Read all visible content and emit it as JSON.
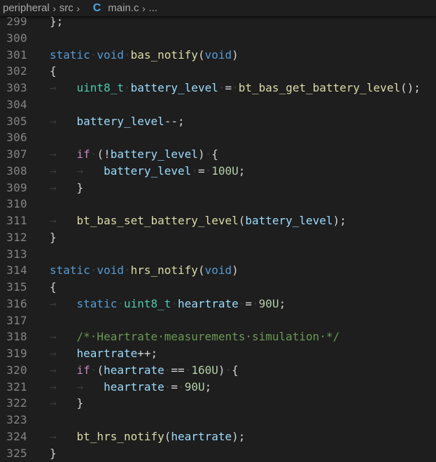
{
  "breadcrumb": {
    "folder": "peripheral",
    "subfolder": "src",
    "file_icon": "C",
    "file": "main.c",
    "more": "..."
  },
  "code_lines": [
    {
      "num": "299",
      "tokens": [
        [
          "p",
          "};"
        ]
      ]
    },
    {
      "num": "300",
      "tokens": []
    },
    {
      "num": "301",
      "tokens": [
        [
          "kw",
          "static"
        ],
        [
          "ws",
          "·"
        ],
        [
          "kw",
          "void"
        ],
        [
          "ws",
          "·"
        ],
        [
          "fn",
          "bas_notify"
        ],
        [
          "p",
          "("
        ],
        [
          "kw",
          "void"
        ],
        [
          "p",
          ")"
        ]
      ]
    },
    {
      "num": "302",
      "tokens": [
        [
          "p",
          "{"
        ]
      ]
    },
    {
      "num": "303",
      "tokens": [
        [
          "ws",
          "→   "
        ],
        [
          "ty",
          "uint8_t"
        ],
        [
          "ws",
          "·"
        ],
        [
          "var",
          "battery_level"
        ],
        [
          "ws",
          "·"
        ],
        [
          "p",
          "="
        ],
        [
          "ws",
          "·"
        ],
        [
          "fn",
          "bt_bas_get_battery_level"
        ],
        [
          "p",
          "();"
        ]
      ]
    },
    {
      "num": "304",
      "tokens": []
    },
    {
      "num": "305",
      "tokens": [
        [
          "ws",
          "→   "
        ],
        [
          "var",
          "battery_level"
        ],
        [
          "p",
          "--;"
        ]
      ]
    },
    {
      "num": "306",
      "tokens": []
    },
    {
      "num": "307",
      "tokens": [
        [
          "ws",
          "→   "
        ],
        [
          "ctl",
          "if"
        ],
        [
          "ws",
          "·"
        ],
        [
          "p",
          "(!"
        ],
        [
          "var",
          "battery_level"
        ],
        [
          "p",
          ")"
        ],
        [
          "ws",
          "·"
        ],
        [
          "p",
          "{"
        ]
      ]
    },
    {
      "num": "308",
      "tokens": [
        [
          "ws",
          "→   →   "
        ],
        [
          "var",
          "battery_level"
        ],
        [
          "ws",
          "·"
        ],
        [
          "p",
          "="
        ],
        [
          "ws",
          "·"
        ],
        [
          "num",
          "100U"
        ],
        [
          "p",
          ";"
        ]
      ]
    },
    {
      "num": "309",
      "tokens": [
        [
          "ws",
          "→   "
        ],
        [
          "p",
          "}"
        ]
      ]
    },
    {
      "num": "310",
      "tokens": []
    },
    {
      "num": "311",
      "tokens": [
        [
          "ws",
          "→   "
        ],
        [
          "fn",
          "bt_bas_set_battery_level"
        ],
        [
          "p",
          "("
        ],
        [
          "var",
          "battery_level"
        ],
        [
          "p",
          ");"
        ]
      ]
    },
    {
      "num": "312",
      "tokens": [
        [
          "p",
          "}"
        ]
      ]
    },
    {
      "num": "313",
      "tokens": []
    },
    {
      "num": "314",
      "tokens": [
        [
          "kw",
          "static"
        ],
        [
          "ws",
          "·"
        ],
        [
          "kw",
          "void"
        ],
        [
          "ws",
          "·"
        ],
        [
          "fn",
          "hrs_notify"
        ],
        [
          "p",
          "("
        ],
        [
          "kw",
          "void"
        ],
        [
          "p",
          ")"
        ]
      ]
    },
    {
      "num": "315",
      "tokens": [
        [
          "p",
          "{"
        ]
      ]
    },
    {
      "num": "316",
      "tokens": [
        [
          "ws",
          "→   "
        ],
        [
          "kw",
          "static"
        ],
        [
          "ws",
          "·"
        ],
        [
          "ty",
          "uint8_t"
        ],
        [
          "ws",
          "·"
        ],
        [
          "var",
          "heartrate"
        ],
        [
          "ws",
          "·"
        ],
        [
          "p",
          "="
        ],
        [
          "ws",
          "·"
        ],
        [
          "num",
          "90U"
        ],
        [
          "p",
          ";"
        ]
      ]
    },
    {
      "num": "317",
      "tokens": []
    },
    {
      "num": "318",
      "tokens": [
        [
          "ws",
          "→   "
        ],
        [
          "cm",
          "/*·Heartrate·measurements·simulation·*/"
        ]
      ]
    },
    {
      "num": "319",
      "tokens": [
        [
          "ws",
          "→   "
        ],
        [
          "var",
          "heartrate"
        ],
        [
          "p",
          "++;"
        ]
      ]
    },
    {
      "num": "320",
      "tokens": [
        [
          "ws",
          "→   "
        ],
        [
          "ctl",
          "if"
        ],
        [
          "ws",
          "·"
        ],
        [
          "p",
          "("
        ],
        [
          "var",
          "heartrate"
        ],
        [
          "ws",
          "·"
        ],
        [
          "p",
          "=="
        ],
        [
          "ws",
          "·"
        ],
        [
          "num",
          "160U"
        ],
        [
          "p",
          ")"
        ],
        [
          "ws",
          "·"
        ],
        [
          "p",
          "{"
        ]
      ]
    },
    {
      "num": "321",
      "tokens": [
        [
          "ws",
          "→   →   "
        ],
        [
          "var",
          "heartrate"
        ],
        [
          "ws",
          "·"
        ],
        [
          "p",
          "="
        ],
        [
          "ws",
          "·"
        ],
        [
          "num",
          "90U"
        ],
        [
          "p",
          ";"
        ]
      ]
    },
    {
      "num": "322",
      "tokens": [
        [
          "ws",
          "→   "
        ],
        [
          "p",
          "}"
        ]
      ]
    },
    {
      "num": "323",
      "tokens": []
    },
    {
      "num": "324",
      "tokens": [
        [
          "ws",
          "→   "
        ],
        [
          "fn",
          "bt_hrs_notify"
        ],
        [
          "p",
          "("
        ],
        [
          "var",
          "heartrate"
        ],
        [
          "p",
          ");"
        ]
      ]
    },
    {
      "num": "325",
      "tokens": [
        [
          "p",
          "}"
        ]
      ]
    }
  ]
}
